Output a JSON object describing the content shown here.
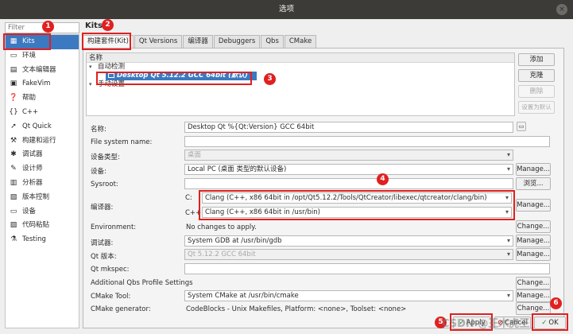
{
  "window": {
    "title": "选项",
    "close_glyph": "×"
  },
  "filter": {
    "placeholder": "Filter"
  },
  "sidebar": {
    "items": [
      {
        "label": "Kits",
        "icon": "kits-icon",
        "glyph": "▦"
      },
      {
        "label": "环境",
        "icon": "monitor-icon",
        "glyph": "▭"
      },
      {
        "label": "文本编辑器",
        "icon": "text-editor-icon",
        "glyph": "▤"
      },
      {
        "label": "FakeVim",
        "icon": "fakevim-icon",
        "glyph": "▣"
      },
      {
        "label": "帮助",
        "icon": "help-icon",
        "glyph": "❓"
      },
      {
        "label": "C++",
        "icon": "cpp-icon",
        "glyph": "{}"
      },
      {
        "label": "Qt Quick",
        "icon": "qtquick-icon",
        "glyph": "➚"
      },
      {
        "label": "构建和运行",
        "icon": "build-run-icon",
        "glyph": "⚒"
      },
      {
        "label": "调试器",
        "icon": "debugger-icon",
        "glyph": "✱"
      },
      {
        "label": "设计师",
        "icon": "designer-icon",
        "glyph": "✎"
      },
      {
        "label": "分析器",
        "icon": "analyzer-icon",
        "glyph": "▥"
      },
      {
        "label": "版本控制",
        "icon": "version-control-icon",
        "glyph": "▧"
      },
      {
        "label": "设备",
        "icon": "devices-icon",
        "glyph": "▭"
      },
      {
        "label": "代码粘贴",
        "icon": "code-paste-icon",
        "glyph": "▨"
      },
      {
        "label": "Testing",
        "icon": "testing-icon",
        "glyph": "⚗"
      }
    ]
  },
  "page_title": "Kits",
  "tabs": [
    "构建套件(Kit)",
    "Qt Versions",
    "编译器",
    "Debuggers",
    "Qbs",
    "CMake"
  ],
  "tree": {
    "header": "名称",
    "group_auto": "自动检测",
    "kit": "Desktop Qt 5.12.2 GCC 64bit (默认)",
    "group_manual": "手动设置"
  },
  "kit_buttons": {
    "add": "添加",
    "clone": "克隆",
    "remove": "删除",
    "make_default": "设置为默认"
  },
  "form": {
    "name_label": "名称:",
    "name_value": "Desktop Qt %{Qt:Version} GCC 64bit",
    "fs_label": "File system name:",
    "device_type_label": "设备类型:",
    "device_type_value": "桌面",
    "device_label": "设备:",
    "device_value": "Local PC (桌面 类型的默认设备)",
    "sysroot_label": "Sysroot:",
    "browse": "浏览...",
    "compiler_label": "编译器:",
    "c_label": "C:",
    "c_value": "Clang (C++, x86 64bit in /opt/Qt5.12.2/Tools/QtCreator/libexec/qtcreator/clang/bin)",
    "cpp_label": "C++:",
    "cpp_value": "Clang (C++, x86 64bit in /usr/bin)",
    "env_label": "Environment:",
    "env_value": "No changes to apply.",
    "debugger_label": "调试器:",
    "debugger_value": "System GDB at /usr/bin/gdb",
    "qt_version_label": "Qt 版本:",
    "qt_version_value": "Qt 5.12.2 GCC 64bit",
    "mkspec_label": "Qt mkspec:",
    "qbs_label": "Additional Qbs Profile Settings",
    "cmake_tool_label": "CMake Tool:",
    "cmake_tool_value": "System CMake at /usr/bin/cmake",
    "cmake_gen_label": "CMake generator:",
    "cmake_gen_value": "CodeBlocks - Unix Makefiles, Platform: <none>, Toolset: <none>",
    "manage": "Manage...",
    "change": "Change..."
  },
  "footer": {
    "apply": "Apply",
    "cancel": "Cancel",
    "ok": "OK"
  },
  "markers": [
    "1",
    "2",
    "3",
    "4",
    "5",
    "6"
  ],
  "watermark": "CSDN @王木虎王",
  "colors": {
    "selection": "#3b79c0",
    "annotation": "#e02020",
    "titlebar": "#3c3b37"
  }
}
